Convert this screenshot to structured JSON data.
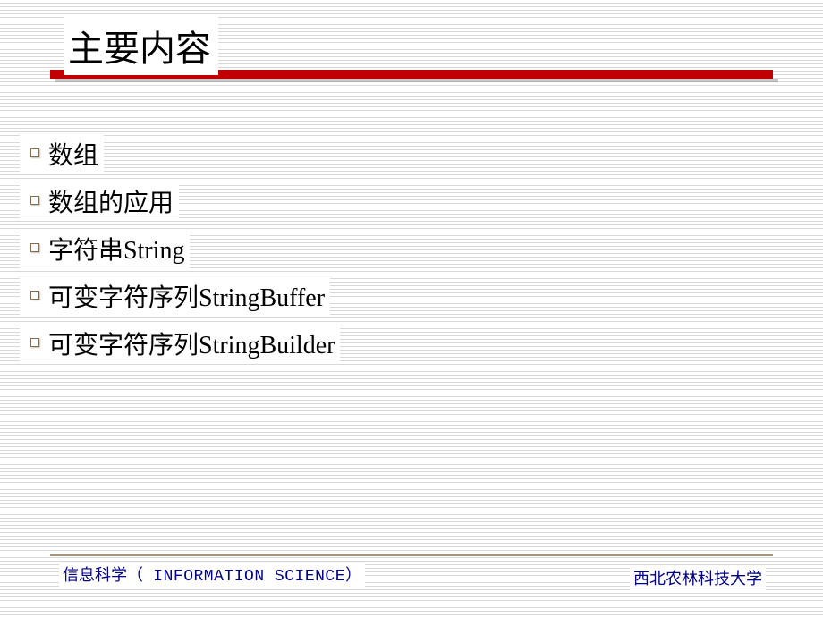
{
  "title": "主要内容",
  "items": [
    "数组",
    "数组的应用",
    "字符串String",
    "可变字符序列StringBuffer",
    "可变字符序列StringBuilder"
  ],
  "footer": {
    "left_cn": "信息科学（",
    "left_en": " INFORMATION SCIENCE",
    "left_close": "）",
    "right": "西北农林科技大学"
  }
}
